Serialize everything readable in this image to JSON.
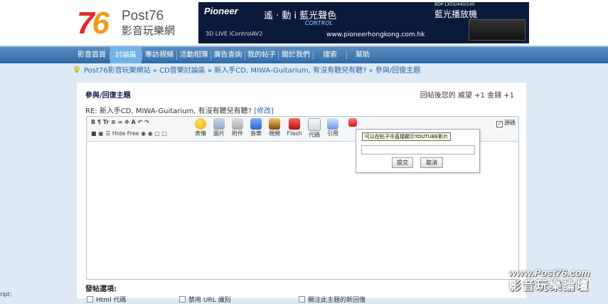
{
  "site": {
    "logo_num_a": "7",
    "logo_num_b": "6",
    "logo_brand": "Post76",
    "logo_cn": "影音玩樂網"
  },
  "banner": {
    "brand": "Pioneer",
    "slogan": "遙 · 動 i 藍光聲色",
    "tagline": "CONTROL",
    "product": "藍光播放機",
    "model": "BDP-LX55/440/140",
    "url": "www.pioneerhongkong.com.hk",
    "logos": "3D   LIVE   iControlAV2"
  },
  "nav": {
    "items": [
      "影音首頁",
      "討論區",
      "專訪視頻",
      "活動相簿",
      "廣告查詢",
      "我的帖子",
      "關於我們",
      "搜索",
      "幫助"
    ],
    "active_index": 1
  },
  "breadcrumb": {
    "text": "Post76影音玩樂網站 » CD音樂討論區 » 新入手CD, MIWA-Guitarium, 有沒有聽兒有聽? » 參與/回復主題"
  },
  "panel": {
    "title": "參與/回復主題",
    "reward": "回帖後您的 威望 +1   金錢 +1",
    "subject": "RE: 新入手CD, MIWA-Guitarium, 有沒有聽兒有聽? ",
    "edit_link": "[修改]"
  },
  "toolbar": {
    "row1": "B  ¶  Tr  ≡  ∞    ✥  A  ↶  ↷",
    "row2": "■  ▣  ☰  Hide  Free    ◉  ◉  ▢  ▢",
    "buttons": [
      "表情",
      "圖片",
      "附件",
      "音樂",
      "視頻",
      "Flash",
      "代碼",
      "引用"
    ],
    "source_label": "源碼",
    "source_checked": "✓"
  },
  "popup": {
    "tooltip": "可以在帖子中直接顯示YOUTUBE影片",
    "input_value": "",
    "submit_label": "提交",
    "cancel_label": "取消"
  },
  "options": {
    "label": "發帖選項:",
    "items": [
      "Html 代碼",
      "禁用 URL 識別",
      "關注此主題的新回復"
    ]
  },
  "watermark": {
    "url": "www.Post76.com",
    "cn": "影音玩樂論壇"
  },
  "corner_text": "ript:"
}
